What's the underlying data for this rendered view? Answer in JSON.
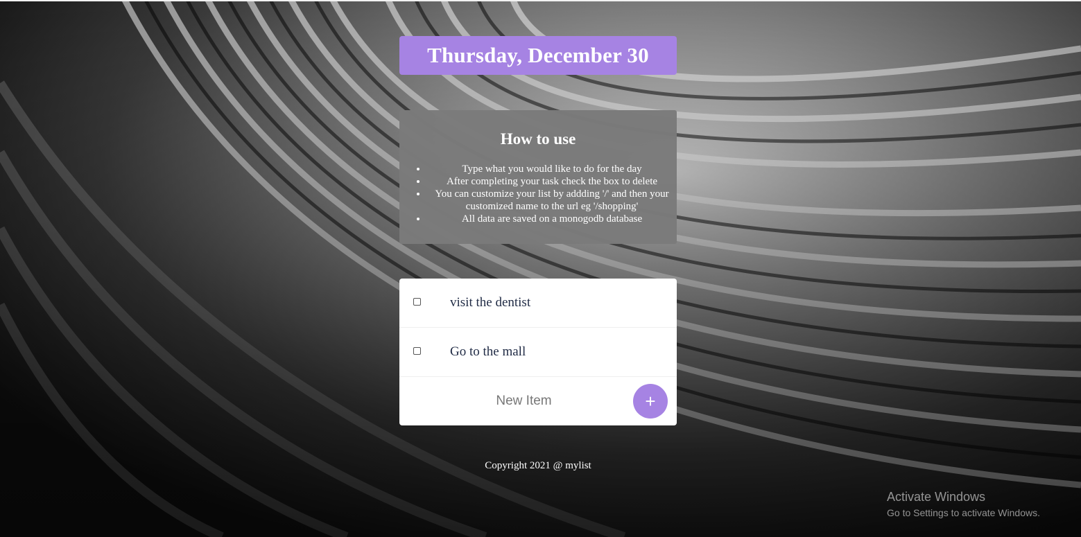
{
  "header": {
    "date_title": "Thursday, December 30"
  },
  "instructions": {
    "heading": "How to use",
    "items": [
      "Type what you would like to do for the day",
      "After completing your task check the box to delete",
      "You can customize your list by addding '/' and then your customized name to the url eg '/shopping'",
      "All data are saved on a monogodb database"
    ]
  },
  "todo": {
    "items": [
      {
        "label": "visit the dentist",
        "checked": false
      },
      {
        "label": "Go to the mall",
        "checked": false
      }
    ],
    "new_item_placeholder": "New Item",
    "add_button_label": "+"
  },
  "footer": {
    "copyright": "Copyright 2021 @ mylist"
  },
  "os_overlay": {
    "activate_title": "Activate Windows",
    "activate_subtitle": "Go to Settings to activate Windows."
  },
  "colors": {
    "accent": "#a683e3",
    "card": "#ffffff",
    "instructions_bg": "#7a7a7a"
  }
}
